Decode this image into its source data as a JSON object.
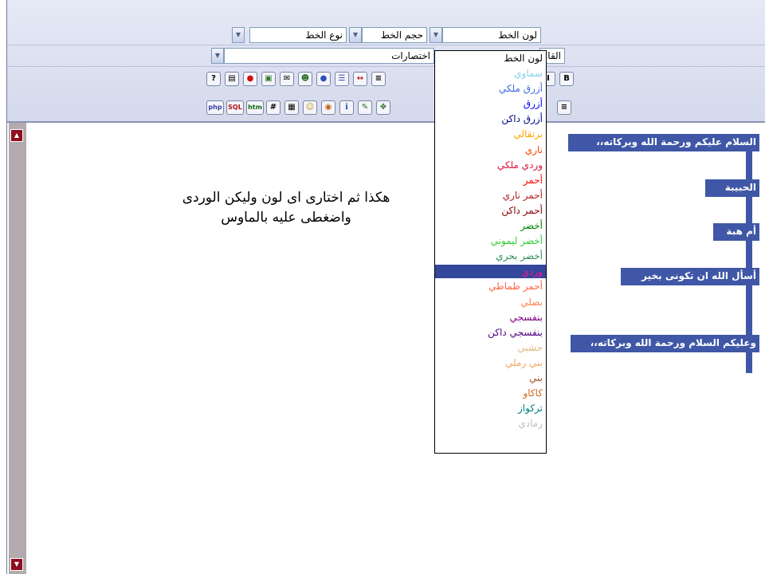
{
  "toolbar": {
    "font_color": "لون الخط",
    "font_size": "حجم الخط",
    "font_type": "نوع الخط",
    "shortcuts": "اختصارات",
    "template_partial": "القا",
    "bold": "B",
    "italic": "I",
    "code_icons": [
      "php",
      "SQL",
      "htm",
      "#"
    ]
  },
  "dropdown": {
    "items": [
      {
        "label": "لون الخط",
        "color": "#000000"
      },
      {
        "label": "سماوي",
        "color": "#87ceeb"
      },
      {
        "label": "أزرق ملكي",
        "color": "#4169e1"
      },
      {
        "label": "أزرق",
        "color": "#0000ff"
      },
      {
        "label": "أزرق داكن",
        "color": "#00008b"
      },
      {
        "label": "برتقالي",
        "color": "#ffa500"
      },
      {
        "label": "ناري",
        "color": "#ff4500"
      },
      {
        "label": "وردي ملكي",
        "color": "#dc143c"
      },
      {
        "label": "أحمر",
        "color": "#ff0000"
      },
      {
        "label": "أحمر ناري",
        "color": "#b22222"
      },
      {
        "label": "أحمر داكن",
        "color": "#8b0000"
      },
      {
        "label": "أخضر",
        "color": "#008000"
      },
      {
        "label": "أخضر ليموني",
        "color": "#32cd32"
      },
      {
        "label": "أخضر بحري",
        "color": "#2e8b57"
      },
      {
        "label": "وردي",
        "color": "#ff1493",
        "selected": true
      },
      {
        "label": "أحمر طماطي",
        "color": "#ff6347"
      },
      {
        "label": "بصلي",
        "color": "#ff7f50"
      },
      {
        "label": "بنفسجي",
        "color": "#800080"
      },
      {
        "label": "بنفسجي داكن",
        "color": "#4b0082"
      },
      {
        "label": "خشبي",
        "color": "#deb887"
      },
      {
        "label": "بني رملي",
        "color": "#f4a460"
      },
      {
        "label": "بني",
        "color": "#a0522d"
      },
      {
        "label": "كاكاو",
        "color": "#d2691e"
      },
      {
        "label": "تركواز",
        "color": "#008080"
      },
      {
        "label": "رمادي",
        "color": "#c0c0c0"
      }
    ]
  },
  "editor": {
    "instruction": "هكذا ثم اختارى اى لون وليكن الوردى واضغطى عليه بالماوس",
    "messages": [
      "السلام عليكم ورحمة الله وبركاته،،",
      "الحبيبة",
      "أم هبة",
      "أسأل الله ان تكونى بخير",
      "وعليكم السلام ورحمة الله وبركاته،،"
    ]
  },
  "colors": {
    "accent": "#3f57a6",
    "scroll_arrow": "#900d1f",
    "scroll_track": "#b3aaad"
  }
}
